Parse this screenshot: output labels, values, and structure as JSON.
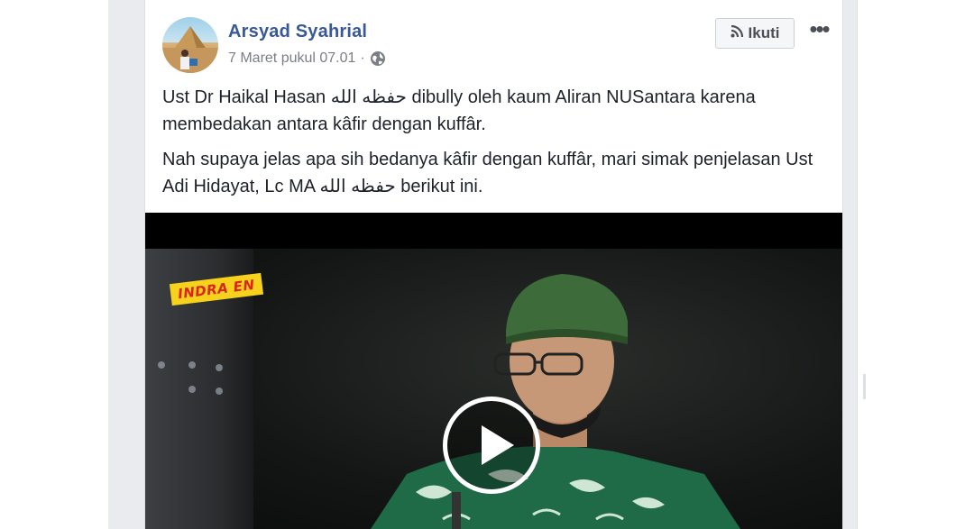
{
  "post": {
    "author": "Arsyad Syahrial",
    "timestamp": "7 Maret pukul 07.01",
    "separator": "·",
    "follow_label": "Ikuti",
    "more_label": "•••",
    "paragraph_1": "Ust Dr Haikal Hasan حفظه الله dibully oleh kaum Aliran NUSantara karena membedakan antara kâfir dengan kuffâr.",
    "paragraph_2": "Nah supaya jelas apa sih bedanya kâfir dengan kuffâr, mari simak penjelasan Ust Adi Hidayat, Lc MA حفظه الله berikut ini."
  },
  "video": {
    "overlay_logo": "INDRA EN"
  },
  "icons": {
    "avatar": "profile-photo",
    "privacy": "globe-icon",
    "follow": "rss-icon",
    "more": "more-icon",
    "play": "play-icon"
  },
  "colors": {
    "link_blue": "#385898",
    "feed_background": "#e9ebee",
    "text": "#1d2129",
    "meta": "#7a7f86"
  }
}
